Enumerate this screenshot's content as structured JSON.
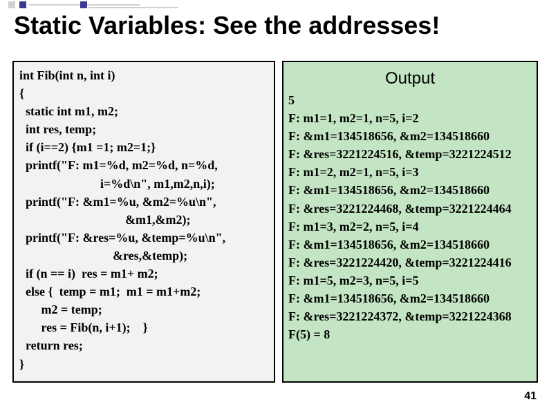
{
  "title": "Static Variables: See the addresses!",
  "code": {
    "lines": [
      "int Fib(int n, int i)",
      "{",
      "  static int m1, m2;",
      "  int res, temp;",
      "  if (i==2) {m1 =1; m2=1;}",
      "  printf(\"F: m1=%d, m2=%d, n=%d,",
      "                          i=%d\\n\", m1,m2,n,i);",
      "  printf(\"F: &m1=%u, &m2=%u\\n\",",
      "                                  &m1,&m2);",
      "  printf(\"F: &res=%u, &temp=%u\\n\",",
      "                              &res,&temp);",
      "  if (n == i)  res = m1+ m2;",
      "  else {  temp = m1;  m1 = m1+m2;",
      "       m2 = temp;",
      "       res = Fib(n, i+1);    }",
      "  return res;",
      "}"
    ]
  },
  "output": {
    "title": "Output",
    "lines": [
      "5",
      "F: m1=1, m2=1, n=5, i=2",
      "F: &m1=134518656, &m2=134518660",
      "F: &res=3221224516, &temp=3221224512",
      "F: m1=2, m2=1, n=5, i=3",
      "F: &m1=134518656, &m2=134518660",
      "F: &res=3221224468, &temp=3221224464",
      "F: m1=3, m2=2, n=5, i=4",
      "F: &m1=134518656, &m2=134518660",
      "F: &res=3221224420, &temp=3221224416",
      "F: m1=5, m2=3, n=5, i=5",
      "F: &m1=134518656, &m2=134518660",
      "F: &res=3221224372, &temp=3221224368",
      "F(5) = 8"
    ]
  },
  "page_number": "41"
}
